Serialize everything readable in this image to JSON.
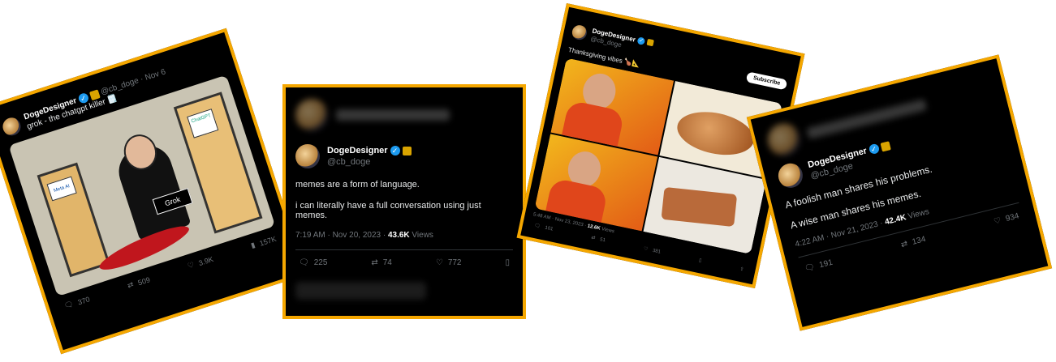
{
  "tweets": [
    {
      "name": "DogeDesigner",
      "handle": "@cb_doge",
      "date": "Nov 6",
      "text": "grok - the chatgpt killer 🗒️",
      "meme": {
        "door1": "Meta AI",
        "door2": "ChatGPT",
        "sign": "Grok"
      },
      "stats": {
        "replies": "370",
        "reposts": "509",
        "likes": "3.9K",
        "views": "157K"
      }
    },
    {
      "name": "DogeDesigner",
      "handle": "@cb_doge",
      "line1": "memes are a form of language.",
      "line2": "i can literally have a full conversation using just memes.",
      "time": "7:19 AM · Nov 20, 2023 ·",
      "views_num": "43.6K",
      "views_label": "Views",
      "stats": {
        "replies": "225",
        "reposts": "74",
        "likes": "772"
      }
    },
    {
      "name": "DogeDesigner",
      "handle": "@cb_doge",
      "text": "Thanksgiving vibes 🍗📐",
      "subscribe": "Subscribe",
      "time": "5:48 AM · Nov 23, 2023 ·",
      "views_num": "12.6K",
      "views_label": "Views",
      "stats": {
        "replies": "101",
        "reposts": "51",
        "likes": "381"
      }
    },
    {
      "name": "DogeDesigner",
      "handle": "@cb_doge",
      "line1": "A foolish man shares his problems.",
      "line2": "A wise man shares his memes.",
      "time": "4:22 AM · Nov 21, 2023 ·",
      "views_num": "42.4K",
      "views_label": "Views",
      "stats": {
        "replies": "191",
        "reposts": "134",
        "likes": "934"
      }
    }
  ],
  "colors": {
    "frame": "#f5a700",
    "background": "#000000",
    "verified": "#1d9bf0"
  },
  "icons": [
    "reply-icon",
    "repost-icon",
    "like-icon",
    "views-icon",
    "bookmark-icon",
    "share-icon"
  ]
}
